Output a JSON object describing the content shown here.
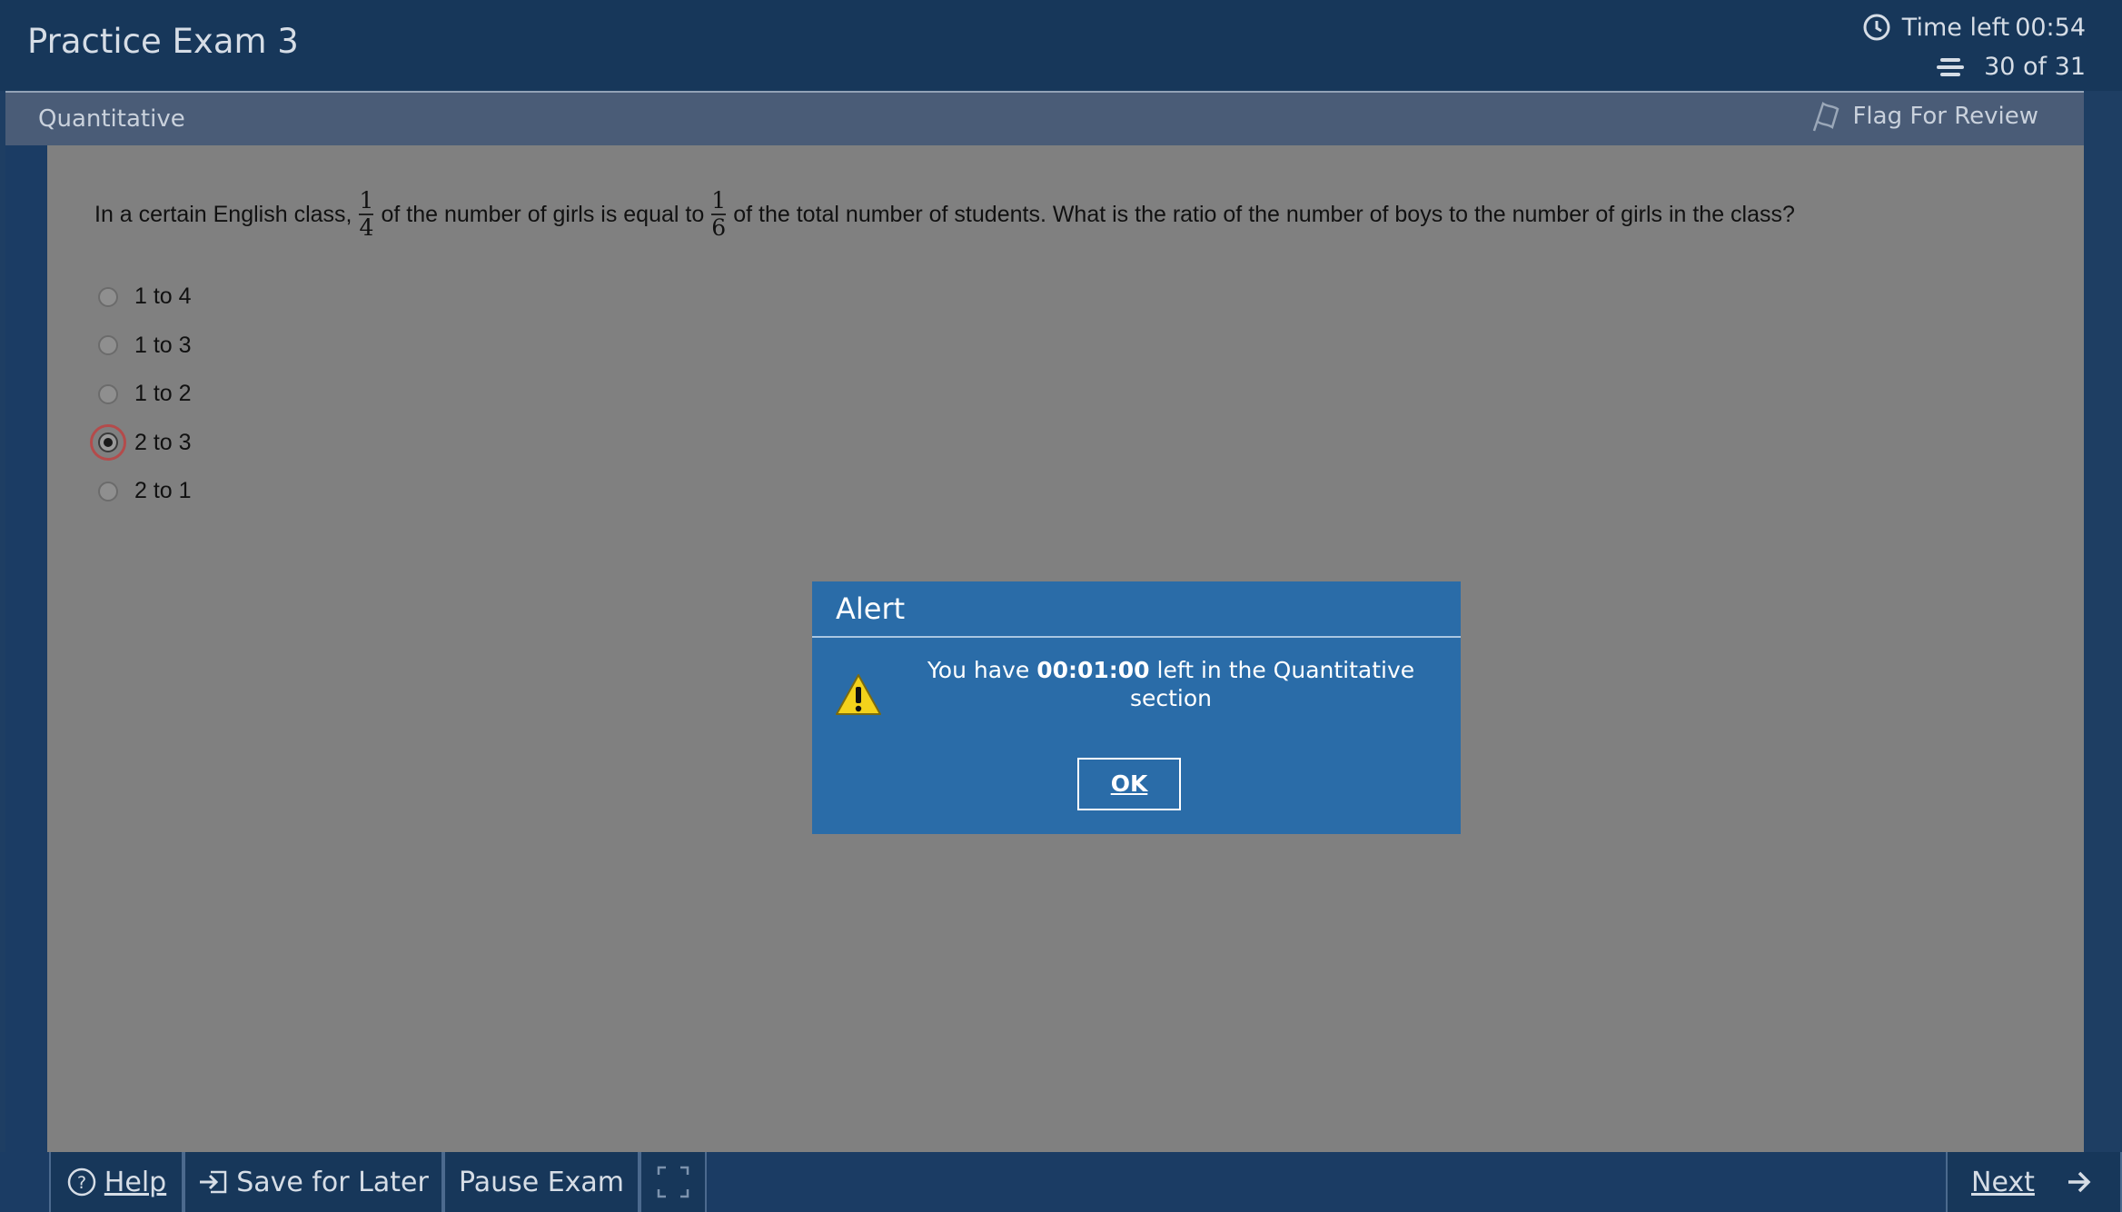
{
  "header": {
    "exam_title": "Practice Exam 3",
    "time_left_label": "Time left",
    "time_left_value": "00:54",
    "question_counter": "30 of 31"
  },
  "section": {
    "name": "Quantitative",
    "flag_label": "Flag For Review"
  },
  "question": {
    "text_part1": "In a certain English class,",
    "frac1_num": "1",
    "frac1_den": "4",
    "text_part2": "of the number of girls is equal to",
    "frac2_num": "1",
    "frac2_den": "6",
    "text_part3": "of the total number of students. What is the ratio of the number of boys to the number of girls in the class?",
    "options": [
      {
        "label": "1 to 4",
        "selected": false
      },
      {
        "label": "1 to 3",
        "selected": false
      },
      {
        "label": "1 to 2",
        "selected": false
      },
      {
        "label": "2 to 3",
        "selected": true
      },
      {
        "label": "2 to 1",
        "selected": false
      }
    ]
  },
  "alert": {
    "title": "Alert",
    "msg_prefix": "You have",
    "msg_time": "00:01:00",
    "msg_suffix": "left in the Quantitative section",
    "ok_label": "OK"
  },
  "footer": {
    "help_label": "Help",
    "save_label": "Save for Later",
    "pause_label": "Pause Exam",
    "next_label": "Next"
  },
  "colors": {
    "header_bg": "#17375a",
    "content_bg": "#808080",
    "dialog_bg": "#2a6ca8",
    "selection_outline": "#b44b4b"
  }
}
